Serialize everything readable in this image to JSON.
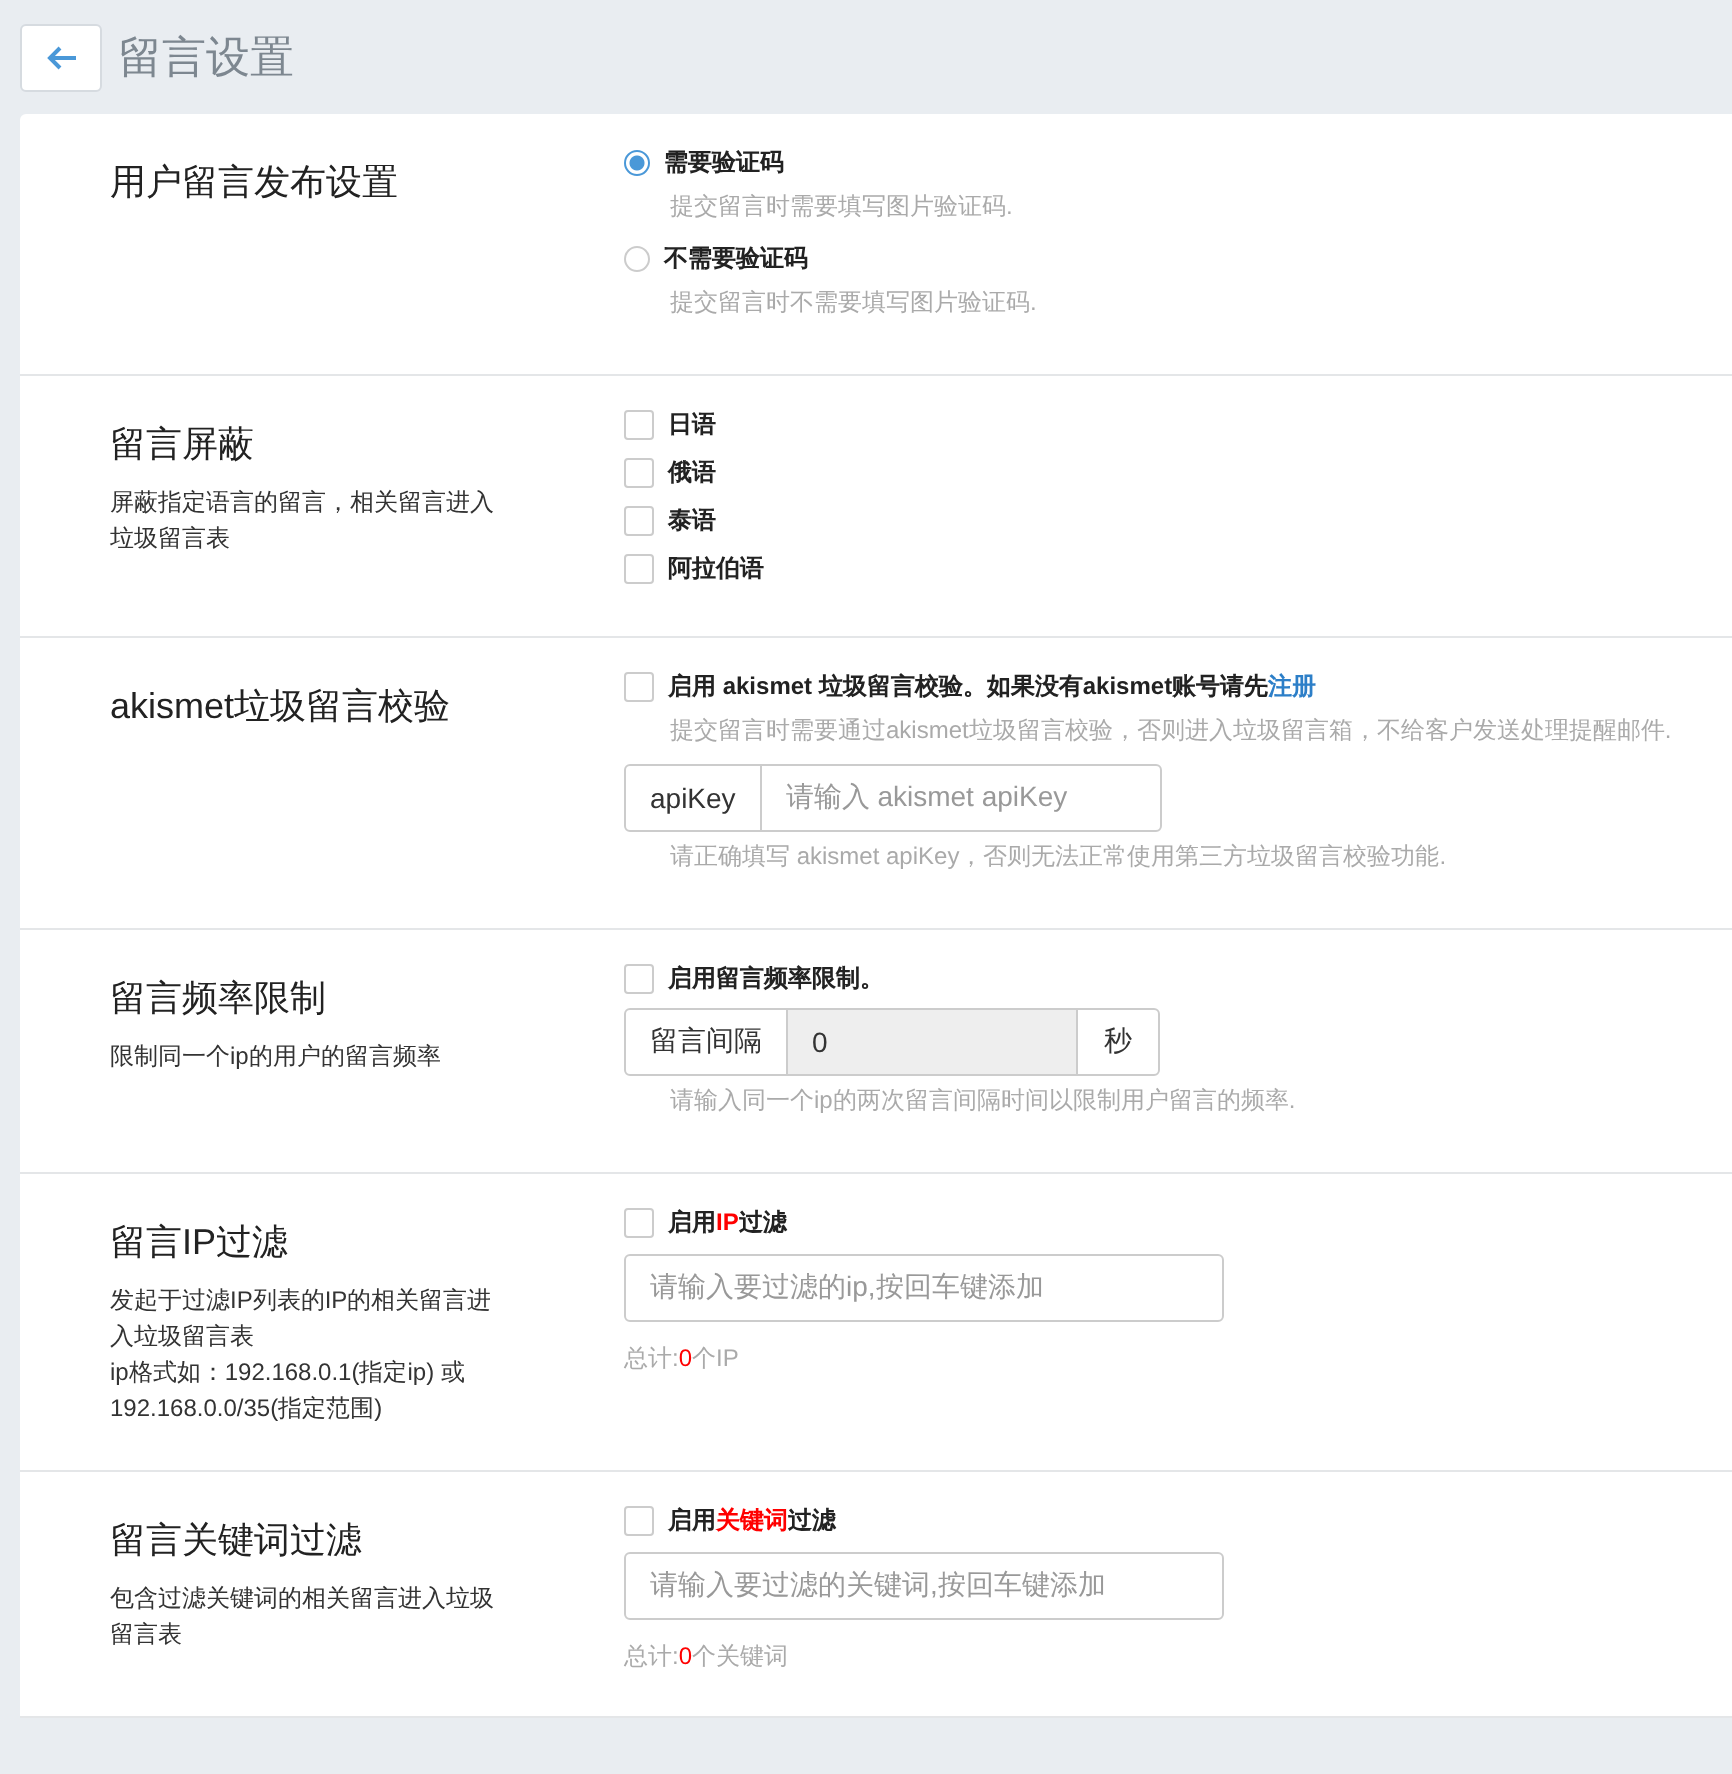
{
  "header": {
    "title": "留言设置"
  },
  "sections": [
    {
      "title": "用户留言发布设置",
      "controls": [
        {
          "kind": "radio",
          "label": "需要验证码",
          "selected": true
        },
        {
          "kind": "hint",
          "text": "提交留言时需要填写图片验证码."
        },
        {
          "kind": "radio",
          "label": "不需要验证码",
          "selected": false
        },
        {
          "kind": "hint",
          "text": "提交留言时不需要填写图片验证码."
        }
      ]
    },
    {
      "title": "留言屏蔽",
      "description": [
        "屏蔽指定语言的留言，相关留言进入垃圾留言表"
      ],
      "controls": [
        {
          "kind": "checkbox",
          "checked": false,
          "label": [
            {
              "text": "日语"
            }
          ]
        },
        {
          "kind": "checkbox",
          "checked": false,
          "label": [
            {
              "text": "俄语"
            }
          ]
        },
        {
          "kind": "checkbox",
          "checked": false,
          "label": [
            {
              "text": "泰语"
            }
          ]
        },
        {
          "kind": "checkbox",
          "checked": false,
          "label": [
            {
              "text": "阿拉伯语"
            }
          ]
        }
      ]
    },
    {
      "title": "akismet垃圾留言校验",
      "controls": [
        {
          "kind": "checkbox",
          "checked": false,
          "label": [
            {
              "text": "启用 akismet 垃圾留言校验。如果没有akismet账号请先"
            },
            {
              "text": "注册",
              "link": true
            }
          ]
        },
        {
          "kind": "hint",
          "text": "提交留言时需要通过akismet垃圾留言校验，否则进入垃圾留言箱，不给客户发送处理提醒邮件."
        },
        {
          "kind": "input-group",
          "prefix": "apiKey",
          "placeholder": "请输入 akismet apiKey",
          "disabled": false
        },
        {
          "kind": "hint",
          "text": "请正确填写 akismet apiKey，否则无法正常使用第三方垃圾留言校验功能."
        }
      ]
    },
    {
      "title": "留言频率限制",
      "description": [
        "限制同一个ip的用户的留言频率"
      ],
      "controls": [
        {
          "kind": "checkbox",
          "checked": false,
          "label": [
            {
              "text": "启用留言频率限制。"
            }
          ]
        },
        {
          "kind": "input-group",
          "prefix": "留言间隔",
          "value": "0",
          "suffix": "秒",
          "disabled": true
        },
        {
          "kind": "hint",
          "text": "请输入同一个ip的两次留言间隔时间以限制用户留言的频率."
        }
      ]
    },
    {
      "title": "留言IP过滤",
      "description": [
        "发起于过滤IP列表的IP的相关留言进入垃圾留言表",
        "ip格式如：192.168.0.1(指定ip) 或 192.168.0.0/35(指定范围)"
      ],
      "controls": [
        {
          "kind": "checkbox",
          "checked": false,
          "label": [
            {
              "text": "启用"
            },
            {
              "text": "IP",
              "highlight": true
            },
            {
              "text": "过滤"
            }
          ]
        },
        {
          "kind": "input",
          "placeholder": "请输入要过滤的ip,按回车键添加"
        },
        {
          "kind": "count",
          "parts": [
            {
              "text": "总计:"
            },
            {
              "text": "0",
              "highlight": true
            },
            {
              "text": "个IP"
            }
          ]
        }
      ]
    },
    {
      "title": "留言关键词过滤",
      "description": [
        "包含过滤关键词的相关留言进入垃圾留言表"
      ],
      "controls": [
        {
          "kind": "checkbox",
          "checked": false,
          "label": [
            {
              "text": "启用"
            },
            {
              "text": "关键词",
              "highlight": true
            },
            {
              "text": "过滤"
            }
          ]
        },
        {
          "kind": "input",
          "placeholder": "请输入要过滤的关键词,按回车键添加"
        },
        {
          "kind": "count",
          "parts": [
            {
              "text": "总计:"
            },
            {
              "text": "0",
              "highlight": true
            },
            {
              "text": "个关键词"
            }
          ]
        }
      ]
    }
  ]
}
